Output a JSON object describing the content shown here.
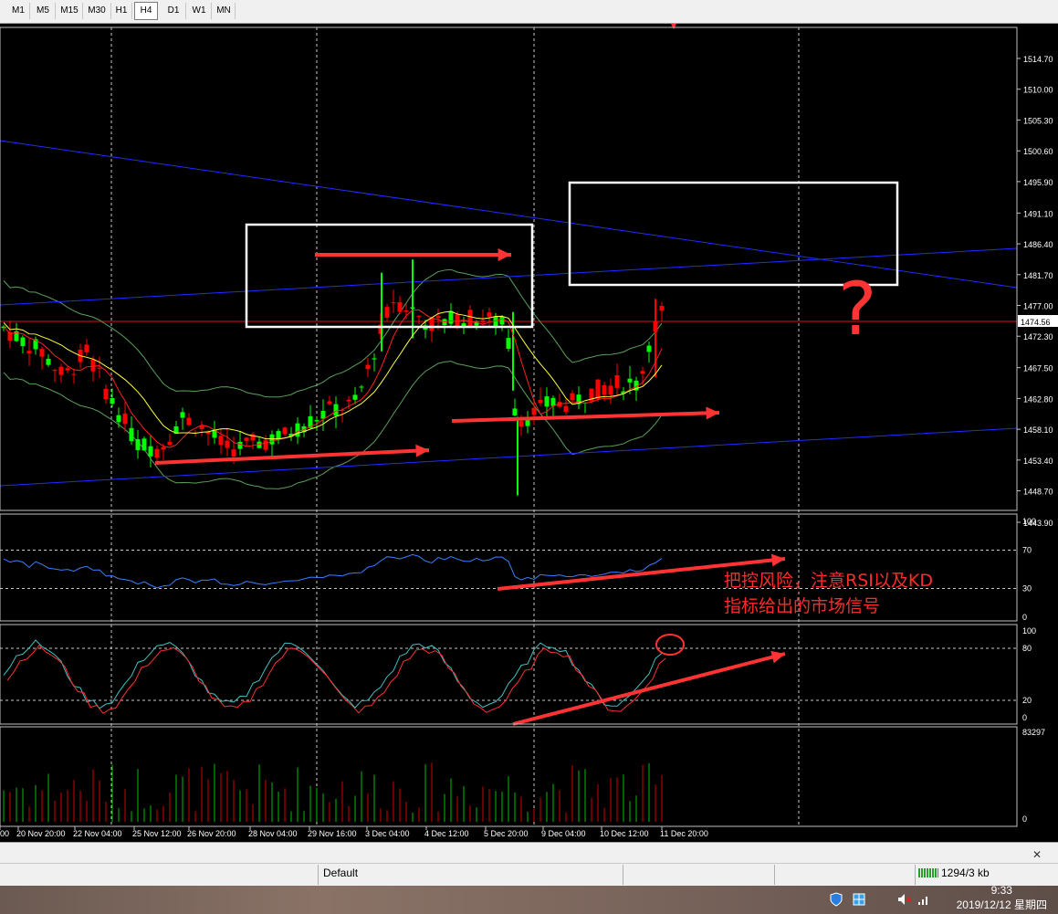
{
  "timeframes": [
    "M1",
    "M5",
    "M15",
    "M30",
    "H1",
    "H4",
    "D1",
    "W1",
    "MN"
  ],
  "active_timeframe": "H4",
  "price_axis": {
    "labels": [
      "1514.70",
      "1510.00",
      "1505.30",
      "1500.60",
      "1495.90",
      "1491.10",
      "1486.40",
      "1481.70",
      "1477.00",
      "1472.30",
      "1467.50",
      "1462.80",
      "1458.10",
      "1453.40",
      "1448.70",
      "1443.90"
    ],
    "current_price": "1474.56"
  },
  "rsi_axis": {
    "labels": [
      "100",
      "70",
      "30",
      "0"
    ]
  },
  "stoch_axis": {
    "labels": [
      "100",
      "80",
      "20",
      "0"
    ]
  },
  "volume_axis": {
    "labels": [
      "83297",
      "0"
    ]
  },
  "time_axis": [
    "00",
    "20 Nov 20:00",
    "22 Nov 04:00",
    "25 Nov 12:00",
    "26 Nov 20:00",
    "28 Nov 04:00",
    "29 Nov 16:00",
    "3 Dec 04:00",
    "4 Dec 12:00",
    "5 Dec 20:00",
    "9 Dec 04:00",
    "10 Dec 12:00",
    "11 Dec 20:00"
  ],
  "annotation": {
    "line1": "把控风险，注意RSI以及KD",
    "line2": "指标给出的市场信号",
    "question_mark": "?"
  },
  "status": {
    "profile": "Default",
    "traffic": "1294/3 kb"
  },
  "taskbar": {
    "time": "9:33",
    "date": "2019/12/12 星期四"
  },
  "colors": {
    "bull": "#00ff00",
    "bear": "#ff0000",
    "annotation": "#ff3333",
    "trend": "#1e2cff",
    "grid": "#c8c8c8"
  }
}
